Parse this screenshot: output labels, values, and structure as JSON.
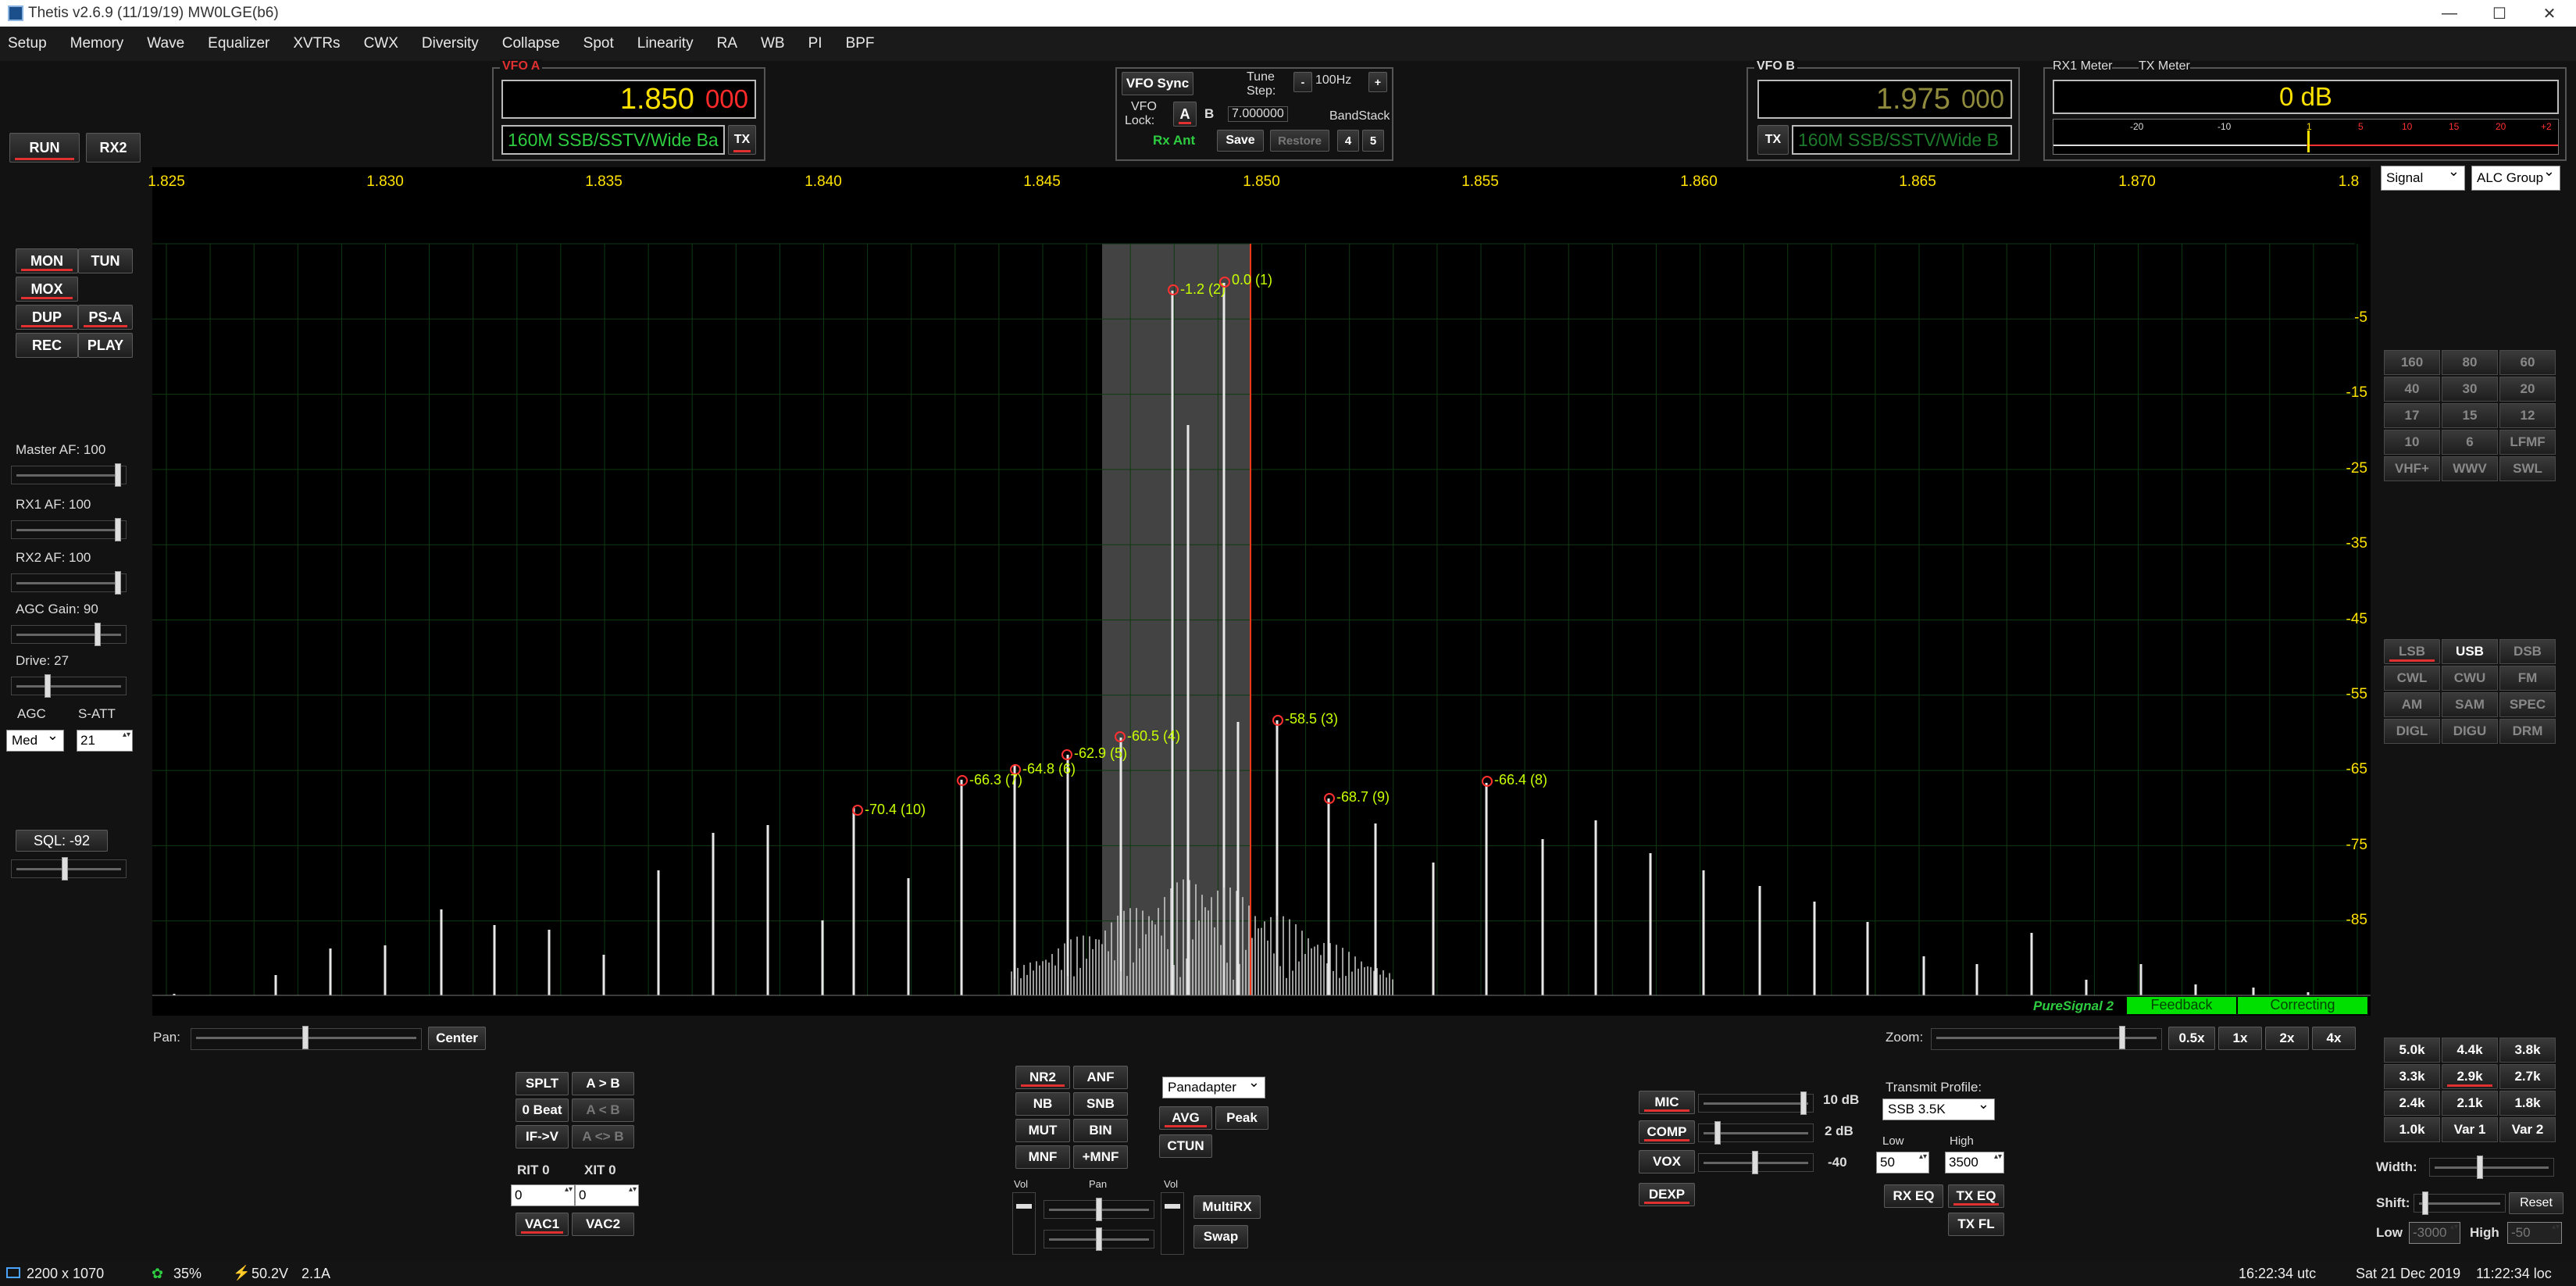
{
  "window": {
    "title": "Thetis v2.6.9 (11/19/19) MW0LGE(b6)",
    "min": "—",
    "max": "☐",
    "close": "✕"
  },
  "menu": [
    "Setup",
    "Memory",
    "Wave",
    "Equalizer",
    "XVTRs",
    "CWX",
    "Diversity",
    "Collapse",
    "Spot",
    "Linearity",
    "RA",
    "WB",
    "PI",
    "BPF"
  ],
  "left": {
    "run": "RUN",
    "rx2": "RX2",
    "mon": "MON",
    "tun": "TUN",
    "mox": "MOX",
    "dup": "DUP",
    "psa": "PS-A",
    "rec": "REC",
    "play": "PLAY",
    "master_af": "Master AF:  100",
    "rx1_af": "RX1 AF:  100",
    "rx2_af": "RX2 AF:  100",
    "agc_gain": "AGC Gain:  90",
    "drive": "Drive:  27",
    "agc": "AGC",
    "satt": "S-ATT",
    "agc_mode": "Med",
    "satt_val": "21",
    "sql": "SQL:  -92"
  },
  "vfoa": {
    "title": "VFO A",
    "freq_main": "1.850",
    "freq_sub": "000",
    "mode": "160M SSB/SSTV/Wide Ba",
    "tx": "TX"
  },
  "vfob": {
    "title": "VFO B",
    "freq_main": "1.975",
    "freq_sub": "000",
    "mode": "160M SSB/SSTV/Wide B",
    "tx": "TX"
  },
  "vfocenter": {
    "sync": "VFO Sync",
    "tune": "Tune",
    "step_lbl": "Step:",
    "minus": "-",
    "step": "100Hz",
    "plus": "+",
    "vfo": "VFO",
    "lock": "Lock:",
    "a": "A",
    "b": "B",
    "lockval": "7.000000",
    "bandstack": "BandStack",
    "rxant": "Rx Ant",
    "save": "Save",
    "restore": "Restore",
    "n4": "4",
    "n5": "5"
  },
  "meter": {
    "rx1": "RX1 Meter",
    "tx": "TX Meter",
    "value": "0 dB",
    "ticks": [
      "-20",
      "-10",
      "1",
      "5",
      "10",
      "15",
      "20",
      "+2"
    ],
    "signal": "Signal",
    "alc": "ALC Group"
  },
  "spectrum": {
    "freqs": [
      "1.825",
      "1.830",
      "1.835",
      "1.840",
      "1.845",
      "1.850",
      "1.855",
      "1.860",
      "1.865",
      "1.870",
      "1.8"
    ],
    "dbs": [
      "-5",
      "-15",
      "-25",
      "-35",
      "-45",
      "-55",
      "-65",
      "-75",
      "-85"
    ],
    "peaks": [
      "-1.2 (2)",
      "0.0 (1)",
      "-58.5 (3)",
      "-60.5 (4)",
      "-62.9 (5)",
      "-64.8 (6)",
      "-66.3 (7)",
      "-68.7 (9)",
      "-66.4 (8)",
      "-70.4 (10)"
    ],
    "puresignal": "PureSignal 2",
    "feedback": "Feedback",
    "correcting": "Correcting"
  },
  "pan": {
    "label": "Pan:",
    "center": "Center",
    "zoom": "Zoom:",
    "z05": "0.5x",
    "z1": "1x",
    "z2": "2x",
    "z4": "4x"
  },
  "bands": [
    "160",
    "80",
    "60",
    "40",
    "30",
    "20",
    "17",
    "15",
    "12",
    "10",
    "6",
    "LFMF",
    "VHF+",
    "WWV",
    "SWL"
  ],
  "modes": [
    "LSB",
    "USB",
    "DSB",
    "CWL",
    "CWU",
    "FM",
    "AM",
    "SAM",
    "SPEC",
    "DIGL",
    "DIGU",
    "DRM"
  ],
  "filters": [
    "5.0k",
    "4.4k",
    "3.8k",
    "3.3k",
    "2.9k",
    "2.7k",
    "2.4k",
    "2.1k",
    "1.8k",
    "1.0k",
    "Var 1",
    "Var 2"
  ],
  "filterctl": {
    "width": "Width:",
    "shift": "Shift:",
    "reset": "Reset",
    "low": "Low",
    "lowval": "-3000",
    "high": "High",
    "highval": "-50"
  },
  "bottom": {
    "splt": "SPLT",
    "atob": "A > B",
    "zerobeat": "0 Beat",
    "btoa": "A < B",
    "ifv": "IF->V",
    "aswap": "A <> B",
    "rit": "RIT  0",
    "xit": "XIT  0",
    "ritval": "0",
    "xitval": "0",
    "vac1": "VAC1",
    "vac2": "VAC2",
    "nr2": "NR2",
    "anf": "ANF",
    "nb": "NB",
    "snb": "SNB",
    "mut": "MUT",
    "bin": "BIN",
    "mnf": "MNF",
    "pmnf": "+MNF",
    "vol": "Vol",
    "panl": "Pan",
    "vol2": "Vol",
    "multirx": "MultiRX",
    "swap": "Swap",
    "panadapter": "Panadapter",
    "avg": "AVG",
    "peak": "Peak",
    "ctun": "CTUN",
    "mic": "MIC",
    "micval": "10 dB",
    "comp": "COMP",
    "compval": "2 dB",
    "vox": "VOX",
    "voxval": "-40",
    "dexp": "DEXP",
    "txprofile": "Transmit Profile:",
    "profile": "SSB 3.5K",
    "low": "Low",
    "high": "High",
    "lowval": "50",
    "highval": "3500",
    "rxeq": "RX EQ",
    "txeq": "TX EQ",
    "txfl": "TX FL"
  },
  "status": {
    "res": "2200 x 1070",
    "cpu": "35%",
    "volt": "50.2V",
    "amp": "2.1A",
    "utc": "16:22:34 utc",
    "date": "Sat 21 Dec 2019",
    "local": "11:22:34 loc"
  }
}
